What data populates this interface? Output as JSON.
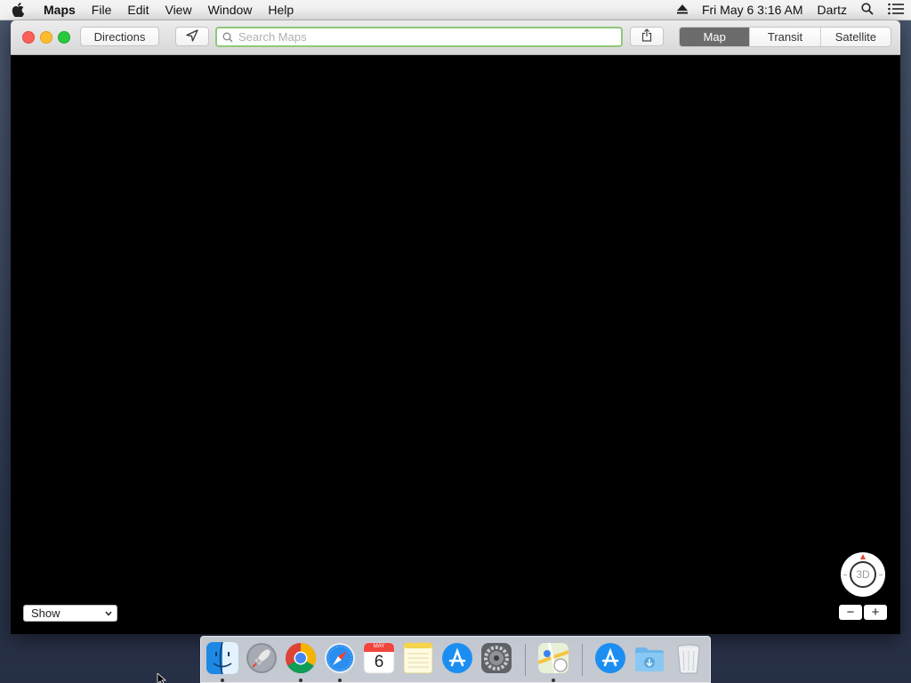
{
  "menubar": {
    "app_name": "Maps",
    "items": [
      "File",
      "Edit",
      "View",
      "Window",
      "Help"
    ],
    "clock": "Fri May 6  3:16 AM",
    "user": "Dartz"
  },
  "toolbar": {
    "directions_label": "Directions",
    "search_placeholder": "Search Maps",
    "search_value": "",
    "map_modes": [
      "Map",
      "Transit",
      "Satellite"
    ],
    "active_mode": "Map"
  },
  "map": {
    "show_select_value": "Show",
    "compass_label": "3D",
    "zoom_out_label": "−",
    "zoom_in_label": "+"
  },
  "dock": {
    "calendar_month": "MAY",
    "calendar_day": "6",
    "apps": [
      "finder",
      "launchpad",
      "chrome",
      "safari",
      "calendar",
      "notes",
      "app-store",
      "system-preferences",
      "maps",
      "app-store-downloads",
      "downloads-folder",
      "trash"
    ]
  },
  "colors": {
    "accent_search_border": "#90c878",
    "active_segment": "#6c6c6c",
    "map_background": "#000000"
  }
}
